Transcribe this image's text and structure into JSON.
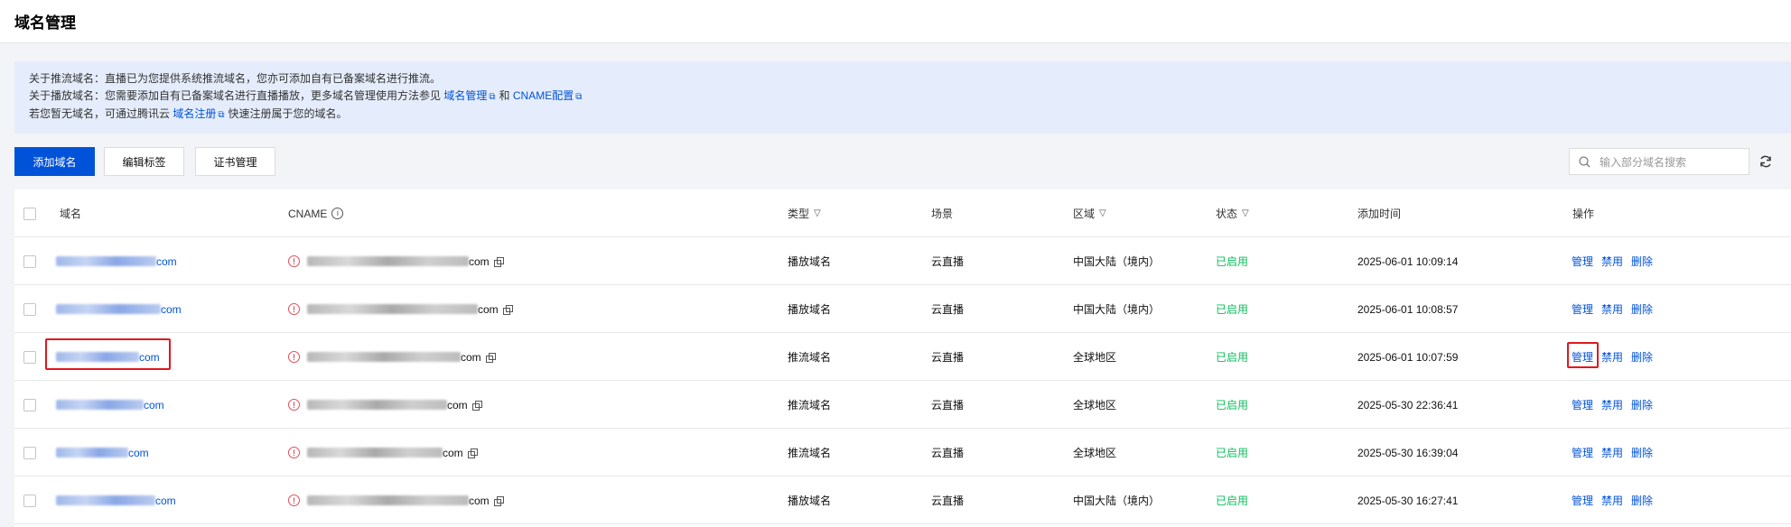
{
  "page": {
    "title": "域名管理"
  },
  "notice": {
    "line1": "关于推流域名：直播已为您提供系统推流域名，您亦可添加自有已备案域名进行推流。",
    "line2_prefix": "关于播放域名：您需要添加自有已备案域名进行直播播放，更多域名管理使用方法参见",
    "line2_link1": "域名管理",
    "line2_mid": "和",
    "line2_link2": "CNAME配置",
    "line3_prefix": "若您暂无域名，可通过腾讯云",
    "line3_link": "域名注册",
    "line3_suffix": "快速注册属于您的域名。"
  },
  "toolbar": {
    "add_domain": "添加域名",
    "edit_tags": "编辑标签",
    "cert_manage": "证书管理"
  },
  "search": {
    "placeholder": "输入部分域名搜索"
  },
  "table": {
    "headers": {
      "domain": "域名",
      "cname": "CNAME",
      "type": "类型",
      "scene": "场景",
      "region": "区域",
      "status": "状态",
      "added_time": "添加时间",
      "actions": "操作"
    },
    "action_labels": {
      "manage": "管理",
      "disable": "禁用",
      "delete": "删除"
    },
    "rows": [
      {
        "domain_suffix": "com",
        "cname_suffix": "com",
        "type": "播放域名",
        "scene": "云直播",
        "region": "中国大陆（境内）",
        "status": "已启用",
        "added_time": "2025-06-01 10:09:14"
      },
      {
        "domain_suffix": "com",
        "cname_suffix": "com",
        "type": "播放域名",
        "scene": "云直播",
        "region": "中国大陆（境内）",
        "status": "已启用",
        "added_time": "2025-06-01 10:08:57"
      },
      {
        "domain_suffix": "com",
        "cname_suffix": "com",
        "type": "推流域名",
        "scene": "云直播",
        "region": "全球地区",
        "status": "已启用",
        "added_time": "2025-06-01 10:07:59"
      },
      {
        "domain_suffix": "com",
        "cname_suffix": "com",
        "type": "推流域名",
        "scene": "云直播",
        "region": "全球地区",
        "status": "已启用",
        "added_time": "2025-05-30 22:36:41"
      },
      {
        "domain_suffix": "com",
        "cname_suffix": "com",
        "type": "推流域名",
        "scene": "云直播",
        "region": "全球地区",
        "status": "已启用",
        "added_time": "2025-05-30 16:39:04"
      },
      {
        "domain_suffix": "com",
        "cname_suffix": "com",
        "type": "播放域名",
        "scene": "云直播",
        "region": "中国大陆（境内）",
        "status": "已启用",
        "added_time": "2025-05-30 16:27:41"
      }
    ]
  },
  "colors": {
    "primary": "#0052d9",
    "success": "#0abf5b",
    "error": "#e34d59",
    "highlight": "#e0191c"
  }
}
